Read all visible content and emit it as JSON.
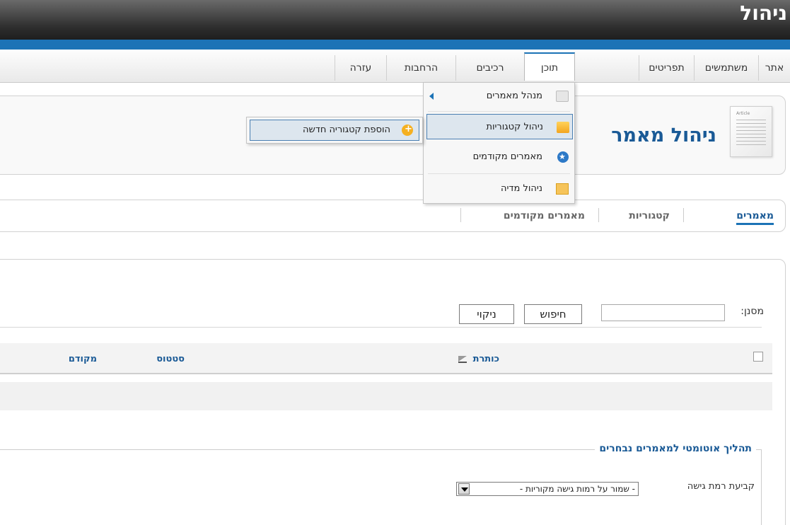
{
  "header": {
    "title": "ניהול"
  },
  "menu": {
    "items": [
      {
        "label": "אתר"
      },
      {
        "label": "משתמשים"
      },
      {
        "label": "תפריטים"
      },
      {
        "label": "תוכן"
      },
      {
        "label": "רכיבים"
      },
      {
        "label": "הרחבות"
      },
      {
        "label": "עזרה"
      }
    ],
    "active": "תוכן"
  },
  "dropdown": {
    "items": [
      {
        "label": "מנהל מאמרים",
        "icon": "article-icon"
      },
      {
        "label": "ניהול קטגוריות",
        "icon": "folder-icon"
      },
      {
        "label": "מאמרים מקודמים",
        "icon": "star-icon"
      },
      {
        "label": "ניהול מדיה",
        "icon": "media-icon"
      }
    ],
    "flyout": {
      "label": "הוספת קטגוריה חדשה",
      "icon": "plus-icon"
    }
  },
  "page": {
    "title": "ניהול מאמר"
  },
  "subtabs": [
    {
      "label": "מאמרים"
    },
    {
      "label": "קטגוריות"
    },
    {
      "label": "מאמרים מקודמים"
    }
  ],
  "filter": {
    "label": "מסנן:",
    "value": "",
    "search_button": "חיפוש",
    "clear_button": "ניקוי"
  },
  "table": {
    "columns": [
      "כותרת",
      "סטטוס",
      "מקודם"
    ]
  },
  "fieldset": {
    "legend": "תהליך אוטומטי למאמרים נבחרים",
    "access_label": "קביעת רמת גישה",
    "access_value": "- שמור על רמות גישה מקוריות -"
  }
}
